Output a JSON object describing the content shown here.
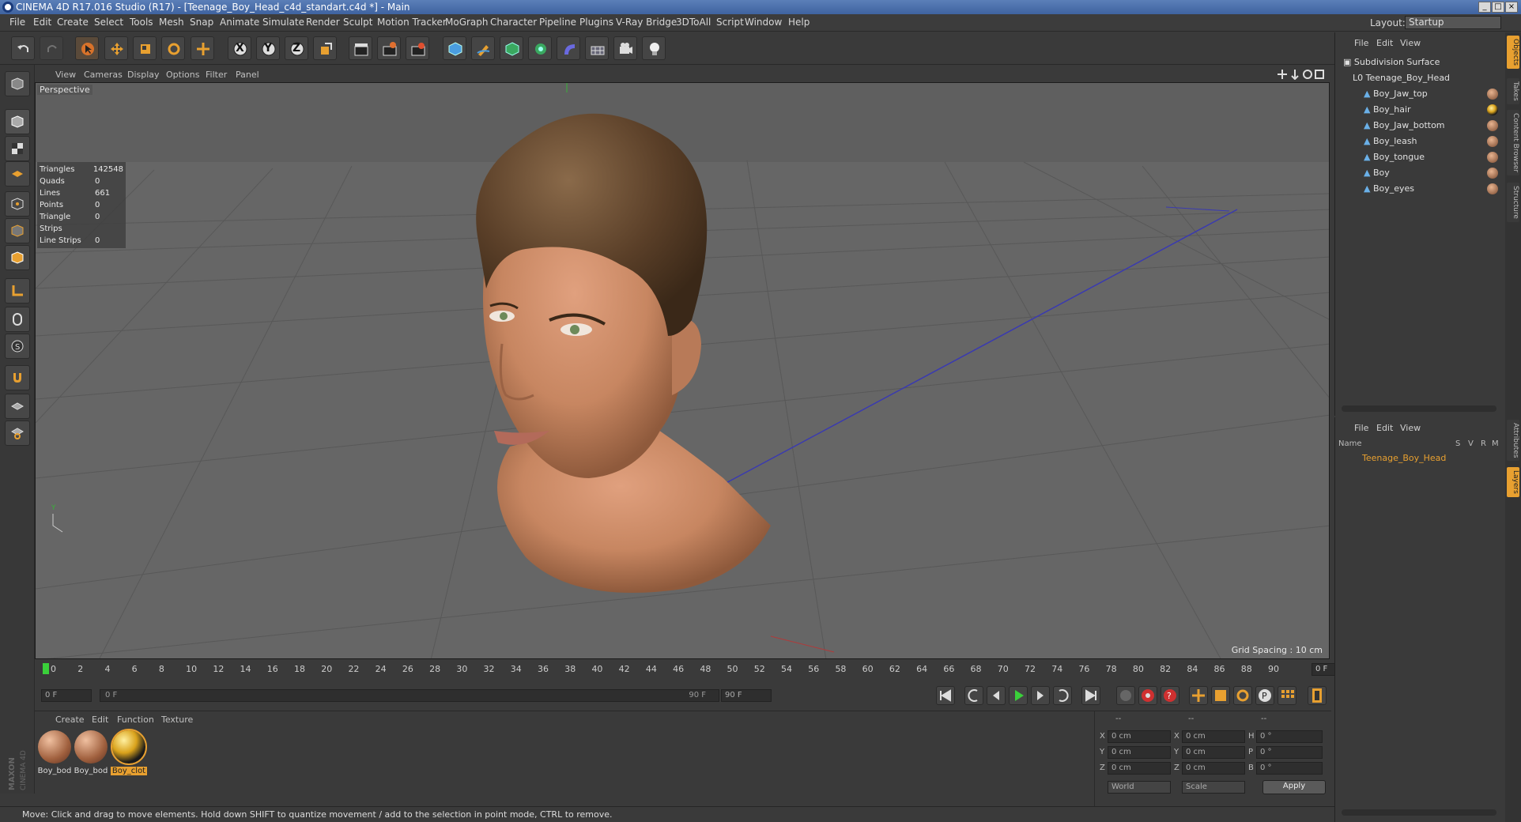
{
  "window": {
    "title": "CINEMA 4D R17.016 Studio (R17) - [Teenage_Boy_Head_c4d_standart.c4d *] - Main"
  },
  "menubar": {
    "items": [
      "File",
      "Edit",
      "Create",
      "Select",
      "Tools",
      "Mesh",
      "Snap",
      "Animate",
      "Simulate",
      "Render",
      "Sculpt",
      "Motion Tracker",
      "MoGraph",
      "Character",
      "Pipeline",
      "Plugins",
      "V-Ray Bridge",
      "3DToAll",
      "Script",
      "Window",
      "Help"
    ],
    "layout_label": "Layout:",
    "layout_value": "Startup"
  },
  "toolbar": {
    "axis_x": "X",
    "axis_y": "Y",
    "axis_z": "Z"
  },
  "viewport": {
    "menu": [
      "View",
      "Cameras",
      "Display",
      "Options",
      "Filter",
      "Panel"
    ],
    "label": "Perspective",
    "stats": [
      {
        "k": "Triangles",
        "v": "142548"
      },
      {
        "k": "Quads",
        "v": "0"
      },
      {
        "k": "Lines",
        "v": "661"
      },
      {
        "k": "Points",
        "v": "0"
      },
      {
        "k": "Triangle Strips",
        "v": "0"
      },
      {
        "k": "Line Strips",
        "v": "0"
      }
    ],
    "grid_spacing": "Grid Spacing : 10 cm"
  },
  "timeline": {
    "ticks": [
      "0",
      "2",
      "4",
      "6",
      "8",
      "10",
      "12",
      "14",
      "16",
      "18",
      "20",
      "22",
      "24",
      "26",
      "28",
      "30",
      "32",
      "34",
      "36",
      "38",
      "40",
      "42",
      "44",
      "46",
      "48",
      "50",
      "52",
      "54",
      "56",
      "58",
      "60",
      "62",
      "64",
      "66",
      "68",
      "70",
      "72",
      "74",
      "76",
      "78",
      "80",
      "82",
      "84",
      "86",
      "88",
      "90"
    ],
    "current_frame": "0 F",
    "start": "0 F",
    "range_start": "0 F",
    "range_end": "90 F",
    "end": "90 F"
  },
  "materials": {
    "menu": [
      "Create",
      "Edit",
      "Function",
      "Texture"
    ],
    "items": [
      {
        "label": "Boy_bod",
        "color": "#b06a4e",
        "selected": false
      },
      {
        "label": "Boy_bod",
        "color": "#b06a4e",
        "selected": false
      },
      {
        "label": "Boy_clot",
        "color": "#d9a21b",
        "selected": true
      }
    ]
  },
  "coords": {
    "header": [
      "--",
      "--",
      "--"
    ],
    "rows": [
      {
        "a": "X",
        "av": "0 cm",
        "b": "X",
        "bv": "0 cm",
        "c": "H",
        "cv": "0 °"
      },
      {
        "a": "Y",
        "av": "0 cm",
        "b": "Y",
        "bv": "0 cm",
        "c": "P",
        "cv": "0 °"
      },
      {
        "a": "Z",
        "av": "0 cm",
        "b": "Z",
        "bv": "0 cm",
        "c": "B",
        "cv": "0 °"
      }
    ],
    "world": "World",
    "scale": "Scale",
    "apply": "Apply"
  },
  "status": "Move: Click and drag to move elements. Hold down SHIFT to quantize movement / add to the selection in point mode, CTRL to remove.",
  "objects": {
    "menu": [
      "File",
      "Edit",
      "View"
    ],
    "items": [
      {
        "name": "Subdivision Surface",
        "indent": 0
      },
      {
        "name": "Teenage_Boy_Head",
        "indent": 1
      },
      {
        "name": "Boy_Jaw_top",
        "indent": 2
      },
      {
        "name": "Boy_hair",
        "indent": 2
      },
      {
        "name": "Boy_Jaw_bottom",
        "indent": 2
      },
      {
        "name": "Boy_leash",
        "indent": 2
      },
      {
        "name": "Boy_tongue",
        "indent": 2
      },
      {
        "name": "Boy",
        "indent": 2
      },
      {
        "name": "Boy_eyes",
        "indent": 2
      }
    ]
  },
  "layers": {
    "menu": [
      "File",
      "Edit",
      "View"
    ],
    "columns": [
      "Name",
      "S",
      "V",
      "R",
      "M"
    ],
    "items": [
      {
        "name": "Teenage_Boy_Head"
      }
    ]
  },
  "sidetabs": [
    "Objects",
    "Takes",
    "Content Browser",
    "Structure",
    "Attributes",
    "Layers"
  ],
  "logo": "MAXON CINEMA 4D"
}
